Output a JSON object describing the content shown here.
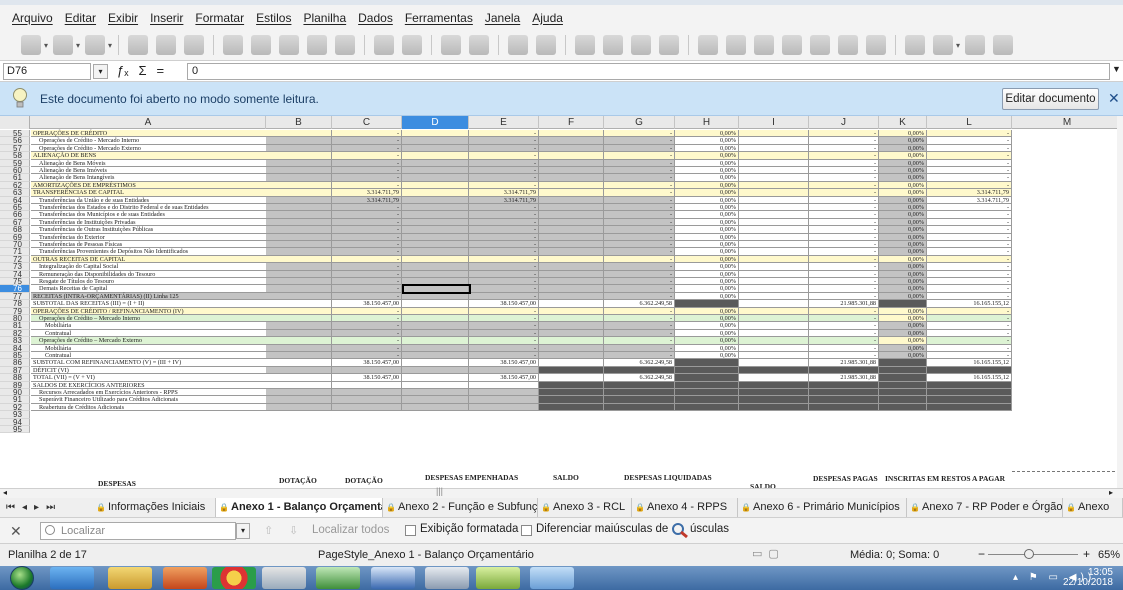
{
  "menu": [
    "Arquivo",
    "Editar",
    "Exibir",
    "Inserir",
    "Formatar",
    "Estilos",
    "Planilha",
    "Dados",
    "Ferramentas",
    "Janela",
    "Ajuda"
  ],
  "formula": {
    "cell_ref": "D76",
    "value": "0",
    "func_glyphs": [
      "ƒₓ",
      "Σ",
      "="
    ]
  },
  "infobar": {
    "text": "Este documento foi aberto no modo somente leitura.",
    "edit_button": "Editar documento"
  },
  "columns": [
    "A",
    "B",
    "C",
    "D",
    "E",
    "F",
    "G",
    "H",
    "I",
    "J",
    "K",
    "L",
    "M"
  ],
  "selected_column": "D",
  "rows": [
    {
      "n": "55",
      "label": "OPERAÇÕES DE CRÉDITO",
      "indent": 0,
      "style": "yellow",
      "h": "0,00%",
      "k": "0,00%"
    },
    {
      "n": "56",
      "label": "Operações de Crédito - Mercado Interno",
      "indent": 1,
      "style": "grey",
      "h": "0,00%",
      "k": "0,00%"
    },
    {
      "n": "57",
      "label": "Operações de Crédito - Mercado Externo",
      "indent": 1,
      "style": "grey",
      "h": "0,00%",
      "k": "0,00%"
    },
    {
      "n": "58",
      "label": "ALIENAÇÃO DE BENS",
      "indent": 0,
      "style": "yellow",
      "h": "0,00%",
      "k": "0,00%"
    },
    {
      "n": "59",
      "label": "Alienação de Bens Móveis",
      "indent": 1,
      "style": "grey",
      "h": "0,00%",
      "k": "0,00%"
    },
    {
      "n": "60",
      "label": "Alienação de Bens Imóveis",
      "indent": 1,
      "style": "grey",
      "h": "0,00%",
      "k": "0,00%"
    },
    {
      "n": "61",
      "label": "Alienação de Bens Intangíveis",
      "indent": 1,
      "style": "grey",
      "h": "0,00%",
      "k": "0,00%"
    },
    {
      "n": "62",
      "label": "AMORTIZAÇÕES DE EMPRÉSTIMOS",
      "indent": 0,
      "style": "yellow",
      "h": "0,00%",
      "k": "0,00%"
    },
    {
      "n": "63",
      "label": "TRANSFERÊNCIAS DE CAPITAL",
      "indent": 0,
      "style": "yellow",
      "c": "3.314.711,79",
      "e": "3.314.711,79",
      "h": "0,00%",
      "k": "0,00%",
      "l": "3.314.711,79"
    },
    {
      "n": "64",
      "label": "Transferências da União e de suas Entidades",
      "indent": 1,
      "style": "grey",
      "c": "3.314.711,79",
      "e": "3.314.711,79",
      "h": "0,00%",
      "k": "0,00%",
      "l": "3.314.711,79"
    },
    {
      "n": "65",
      "label": "Transferências dos Estados e do Distrito Federal e de suas Entidades",
      "indent": 1,
      "style": "grey",
      "h": "0,00%",
      "k": "0,00%"
    },
    {
      "n": "66",
      "label": "Transferências dos Municípios e de suas Entidades",
      "indent": 1,
      "style": "grey",
      "h": "0,00%",
      "k": "0,00%"
    },
    {
      "n": "67",
      "label": "Transferências de Instituições Privadas",
      "indent": 1,
      "style": "grey",
      "h": "0,00%",
      "k": "0,00%"
    },
    {
      "n": "68",
      "label": "Transferências de Outras Instituições Públicas",
      "indent": 1,
      "style": "grey",
      "h": "0,00%",
      "k": "0,00%"
    },
    {
      "n": "69",
      "label": "Transferências do Exterior",
      "indent": 1,
      "style": "grey",
      "h": "0,00%",
      "k": "0,00%"
    },
    {
      "n": "70",
      "label": "Transferências de Pessoas Físicas",
      "indent": 1,
      "style": "grey",
      "h": "0,00%",
      "k": "0,00%"
    },
    {
      "n": "71",
      "label": "Transferências Provenientes de Depósitos Não Identificados",
      "indent": 1,
      "style": "grey",
      "h": "0,00%",
      "k": "0,00%"
    },
    {
      "n": "72",
      "label": "OUTRAS RECEITAS DE CAPITAL",
      "indent": 0,
      "style": "yellow",
      "h": "0,00%",
      "k": "0,00%"
    },
    {
      "n": "73",
      "label": "Integralização do Capital Social",
      "indent": 1,
      "style": "grey",
      "h": "0,00%",
      "k": "0,00%"
    },
    {
      "n": "74",
      "label": "Remuneração das Disponibilidades do Tesouro",
      "indent": 1,
      "style": "grey",
      "h": "0,00%",
      "k": "0,00%"
    },
    {
      "n": "75",
      "label": "Resgate de Títulos do Tesouro",
      "indent": 1,
      "style": "grey",
      "h": "0,00%",
      "k": "0,00%"
    },
    {
      "n": "76",
      "label": "Demais Receitas de Capital",
      "indent": 1,
      "style": "grey",
      "h": "0,00%",
      "k": "0,00%"
    },
    {
      "n": "77",
      "label": "RECEITAS (INTRA-ORÇAMENTÁRIAS) (II)   Linha 125",
      "indent": 0,
      "style": "grey",
      "h": "0,00%",
      "k": "0,00%"
    },
    {
      "n": "78",
      "label": "SUBTOTAL DAS RECEITAS (III) = (I + II)",
      "indent": 0,
      "style": "total",
      "c": "38.150.457,00",
      "e": "38.150.457,00",
      "g": "6.362.249,58",
      "j": "21.985.301,88",
      "l": "16.165.155,12"
    },
    {
      "n": "79",
      "label": "OPERAÇÕES DE CRÉDITO / REFINANCIAMENTO (IV)",
      "indent": 0,
      "style": "yellow",
      "h": "0,00%",
      "k": "0,00%"
    },
    {
      "n": "80",
      "label": "Operações de Crédito – Mercado Interno",
      "indent": 1,
      "style": "green",
      "h": "0,00%",
      "k": "0,00%"
    },
    {
      "n": "81",
      "label": "Mobiliária",
      "indent": 2,
      "style": "grey",
      "h": "0,00%",
      "k": "0,00%"
    },
    {
      "n": "82",
      "label": "Contratual",
      "indent": 2,
      "style": "grey",
      "h": "0,00%",
      "k": "0,00%"
    },
    {
      "n": "83",
      "label": "Operações de Crédito – Mercado Externo",
      "indent": 1,
      "style": "green",
      "h": "0,00%",
      "k": "0,00%"
    },
    {
      "n": "84",
      "label": "Mobiliária",
      "indent": 2,
      "style": "grey",
      "h": "0,00%",
      "k": "0,00%"
    },
    {
      "n": "85",
      "label": "Contratual",
      "indent": 2,
      "style": "grey",
      "h": "0,00%",
      "k": "0,00%"
    },
    {
      "n": "86",
      "label": "SUBTOTAL COM REFINANCIAMENTO (V) = (III + IV)",
      "indent": 0,
      "style": "total",
      "c": "38.150.457,00",
      "e": "38.150.457,00",
      "g": "6.362.249,58",
      "j": "21.985.301,88",
      "l": "16.165.155,12"
    },
    {
      "n": "87",
      "label": "DÉFICIT (VI)",
      "indent": 0,
      "style": "dark"
    },
    {
      "n": "88",
      "label": "TOTAL (VII) = (V + VI)",
      "indent": 0,
      "style": "total",
      "c": "38.150.457,00",
      "e": "38.150.457,00",
      "g": "6.362.249,58",
      "j": "21.985.301,88",
      "l": "16.165.155,12"
    },
    {
      "n": "89",
      "label": "SALDOS DE EXERCÍCIOS ANTERIORES",
      "indent": 0,
      "style": "greyonly"
    },
    {
      "n": "90",
      "label": "Recursos Arrecadados em Exercícios Anteriores - RPPS",
      "indent": 1,
      "style": "dark"
    },
    {
      "n": "91",
      "label": "Superávit Financeiro Utilizado para Créditos Adicionais",
      "indent": 1,
      "style": "dark"
    },
    {
      "n": "92",
      "label": "Reabertura de Créditos Adicionais",
      "indent": 1,
      "style": "dark"
    },
    {
      "n": "93",
      "label": "",
      "indent": 0,
      "style": "blank"
    },
    {
      "n": "94",
      "label": "",
      "indent": 0,
      "style": "blank"
    },
    {
      "n": "95",
      "label": "",
      "indent": 0,
      "style": "blank"
    }
  ],
  "bottom_headers": {
    "despesas": "DESPESAS",
    "dotacao_inicial": "DOTAÇÃO",
    "dotacao_atualizada": "DOTAÇÃO",
    "empenhadas": "DESPESAS EMPENHADAS",
    "saldo": "SALDO",
    "liquidadas": "DESPESAS LIQUIDADAS",
    "saldo2": "SALDO",
    "pagas": "DESPESAS PAGAS",
    "restos": "INSCRITAS EM RESTOS A PAGAR"
  },
  "tabs": [
    {
      "label": "Informações Iniciais",
      "active": false
    },
    {
      "label": "Anexo 1 - Balanço Orçamentário",
      "active": true
    },
    {
      "label": "Anexo 2 - Função e Subfunção",
      "active": false
    },
    {
      "label": "Anexo 3 - RCL",
      "active": false
    },
    {
      "label": "Anexo 4 - RPPS",
      "active": false
    },
    {
      "label": "Anexo 6 - Primário Municípios",
      "active": false
    },
    {
      "label": "Anexo 7 - RP Poder e Órgão",
      "active": false
    },
    {
      "label": "Anexo",
      "active": false
    }
  ],
  "find": {
    "placeholder": "Localizar",
    "find_all": "Localizar todos",
    "formatted": "Exibição formatada",
    "match_case": "Diferenciar maiúsculas de minúsculas"
  },
  "status": {
    "sheet": "Planilha 2 de 17",
    "page_style": "PageStyle_Anexo 1 - Balanço Orçamentário",
    "sum": "Média: 0; Soma: 0",
    "zoom": "65%"
  },
  "tray": {
    "time": "13:05",
    "date": "22/10/2018"
  },
  "colors": {
    "info_bg": "#cbe3f7",
    "selection": "#3c8de0",
    "yellow_row": "#fff9cc",
    "grey_cell": "#c3c3c3",
    "dark_cell": "#5a5a5a",
    "green_row": "#ddf3d4"
  }
}
